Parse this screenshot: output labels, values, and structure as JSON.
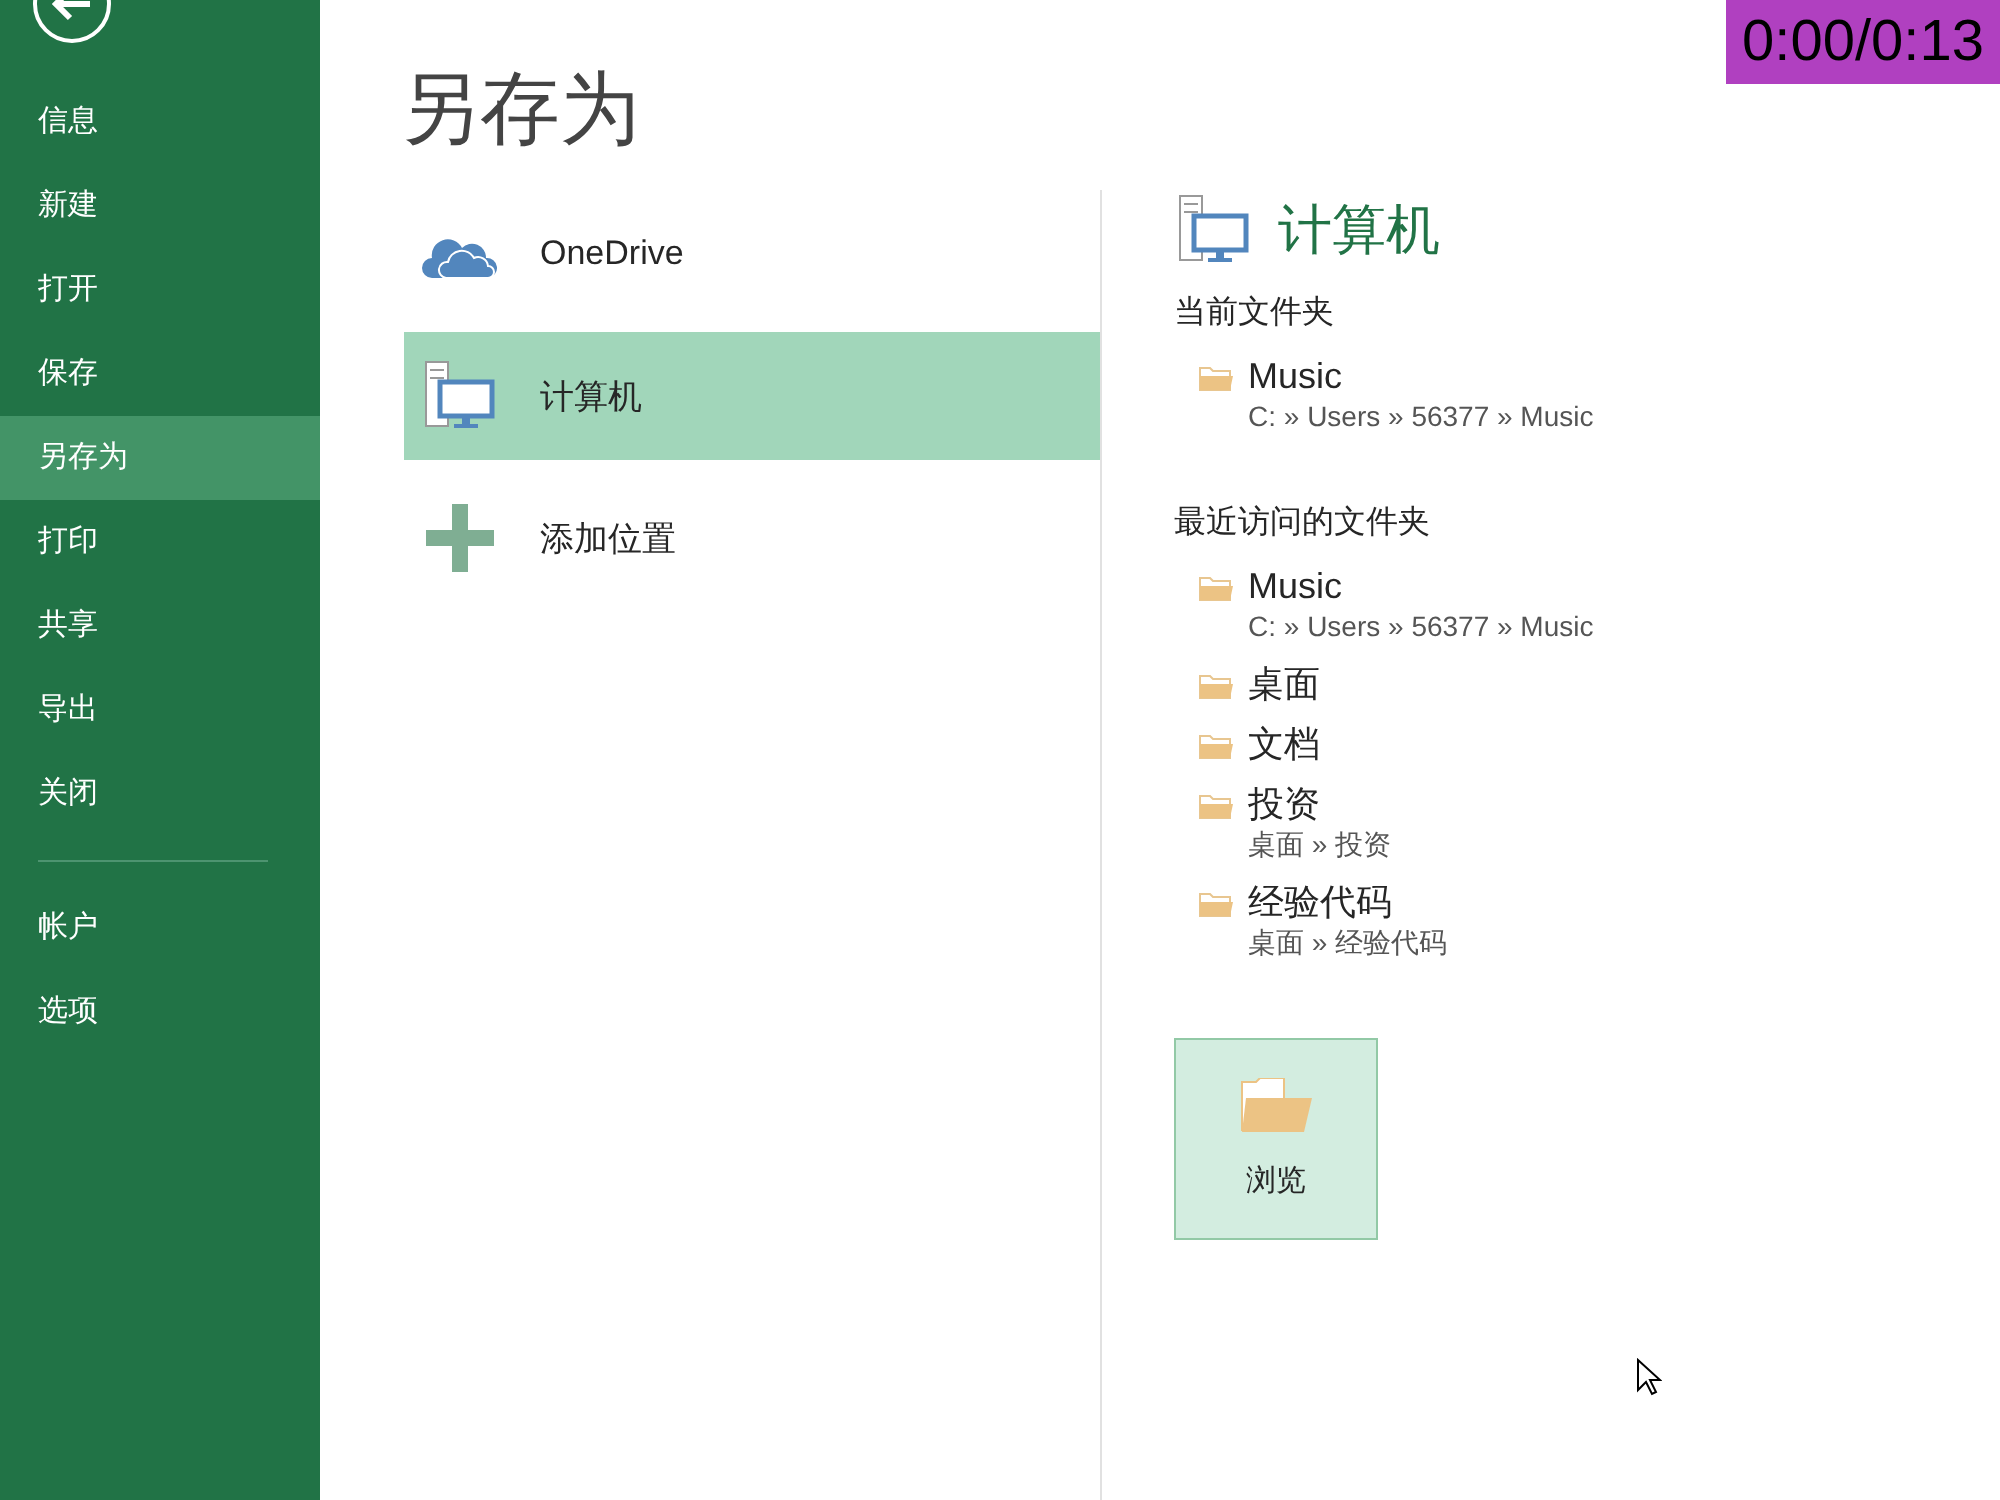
{
  "sidebar": {
    "items": [
      {
        "label": "信息",
        "selected": false
      },
      {
        "label": "新建",
        "selected": false
      },
      {
        "label": "打开",
        "selected": false
      },
      {
        "label": "保存",
        "selected": false
      },
      {
        "label": "另存为",
        "selected": true
      },
      {
        "label": "打印",
        "selected": false
      },
      {
        "label": "共享",
        "selected": false
      },
      {
        "label": "导出",
        "selected": false
      },
      {
        "label": "关闭",
        "selected": false
      }
    ],
    "bottom_items": [
      {
        "label": "帐户",
        "selected": false
      },
      {
        "label": "选项",
        "selected": false
      }
    ]
  },
  "page_title": "另存为",
  "places": [
    {
      "kind": "onedrive",
      "label": "OneDrive",
      "selected": false
    },
    {
      "kind": "computer",
      "label": "计算机",
      "selected": true
    },
    {
      "kind": "add",
      "label": "添加位置",
      "selected": false
    }
  ],
  "detail": {
    "title": "计算机",
    "sections": [
      {
        "heading": "当前文件夹",
        "folders": [
          {
            "name": "Music",
            "path": "C: » Users » 56377 » Music"
          }
        ]
      },
      {
        "heading": "最近访问的文件夹",
        "folders": [
          {
            "name": "Music",
            "path": "C: » Users » 56377 » Music"
          },
          {
            "name": "桌面"
          },
          {
            "name": "文档"
          },
          {
            "name": "投资",
            "path": "桌面 » 投资"
          },
          {
            "name": "经验代码",
            "path": "桌面 » 经验代码"
          }
        ]
      }
    ],
    "browse_button": "浏览"
  },
  "video_timer": "0:00/0:13"
}
